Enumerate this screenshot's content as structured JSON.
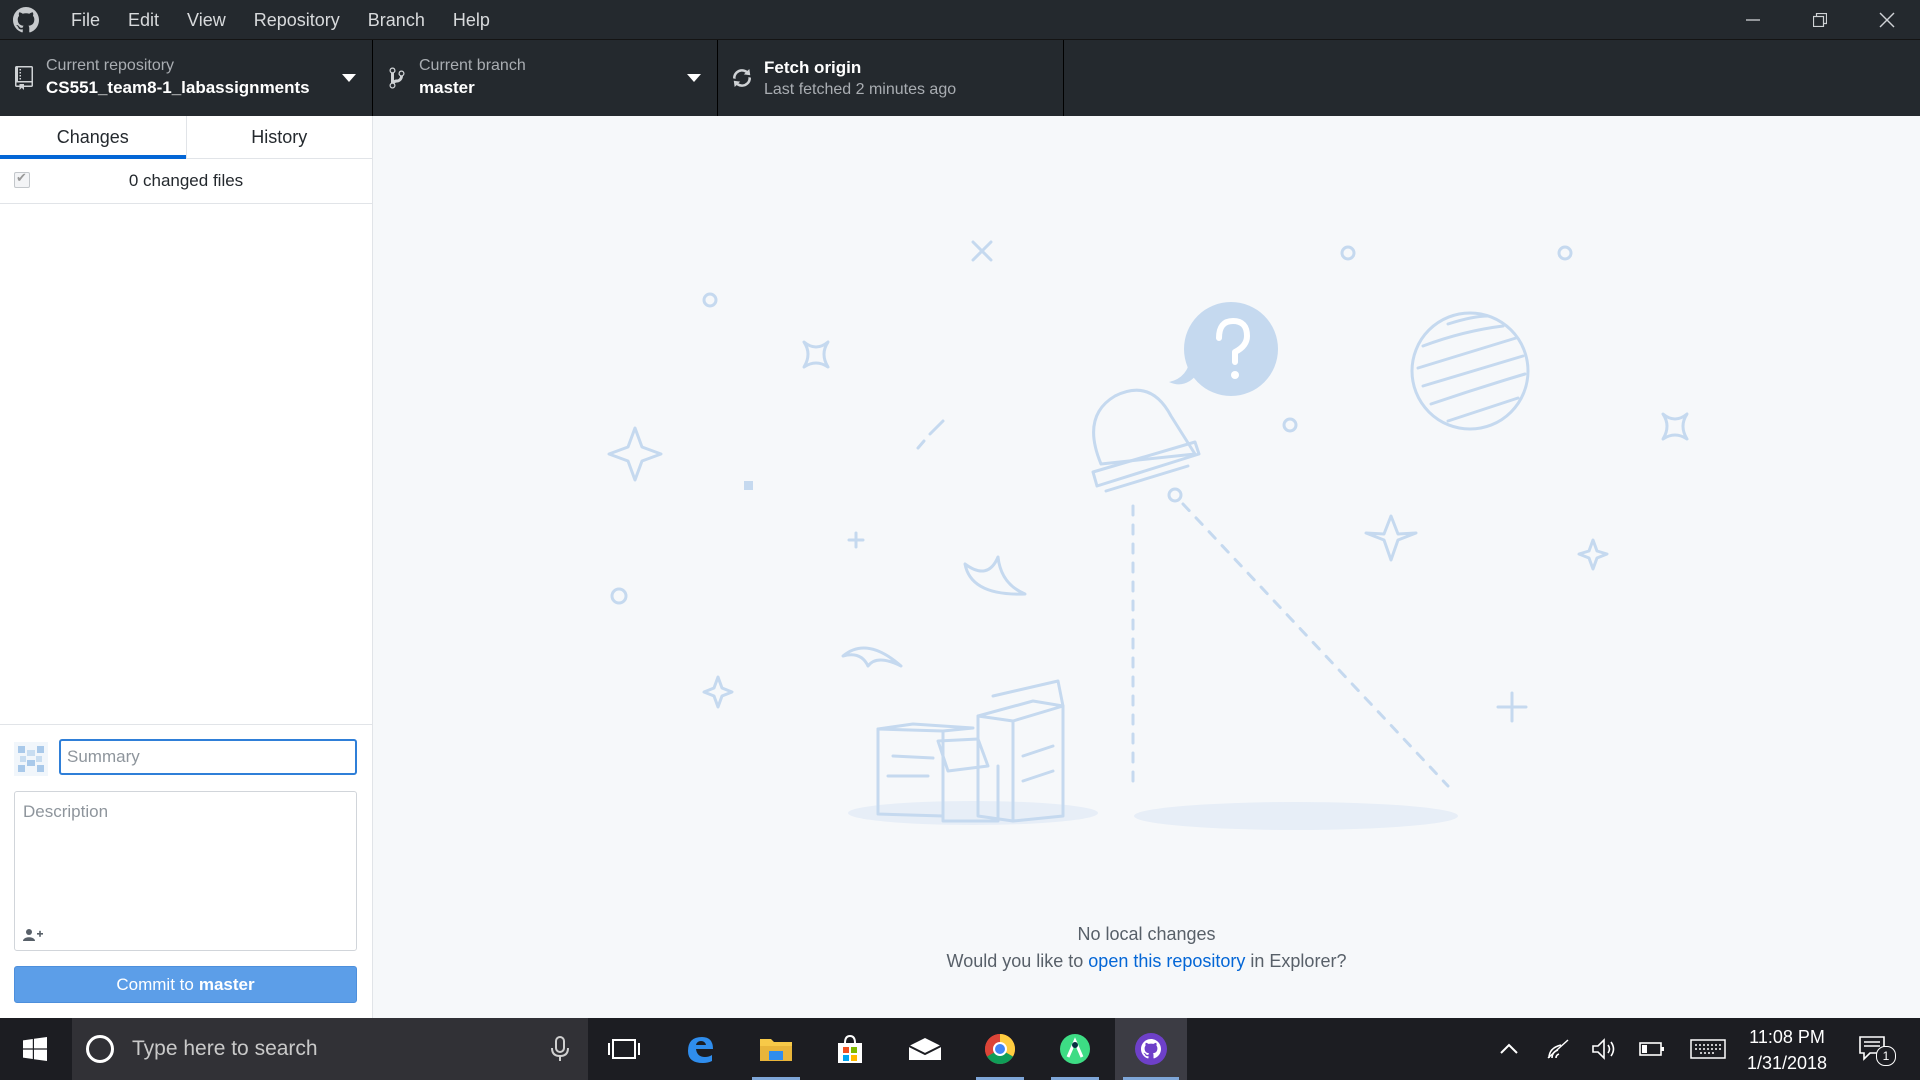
{
  "menu": [
    "File",
    "Edit",
    "View",
    "Repository",
    "Branch",
    "Help"
  ],
  "toolbar": {
    "repo_label": "Current repository",
    "repo_value": "CS551_team8-1_labassignments",
    "branch_label": "Current branch",
    "branch_value": "master",
    "fetch_title": "Fetch origin",
    "fetch_sub": "Last fetched 2 minutes ago"
  },
  "sidebar": {
    "tabs": [
      "Changes",
      "History"
    ],
    "selected_tab": "Changes",
    "changed_files": "0 changed files"
  },
  "commit": {
    "summary_placeholder": "Summary",
    "description_placeholder": "Description",
    "button_prefix": "Commit to",
    "button_branch": "master"
  },
  "main": {
    "heading": "No local changes",
    "prompt_prefix": "Would you like to",
    "link_text": "open this repository",
    "prompt_suffix": "in Explorer?"
  },
  "taskbar": {
    "search_placeholder": "Type here to search",
    "time": "11:08 PM",
    "date": "1/31/2018",
    "notification_count": "1",
    "apps": [
      "task-view",
      "edge",
      "file-explorer",
      "store",
      "mail",
      "chrome",
      "android-studio",
      "github-desktop"
    ]
  },
  "colors": {
    "accent": "#0366d6",
    "commit_button": "#5c9ee8",
    "toolbar": "#24292e",
    "illustration": "#c5d9ef"
  }
}
